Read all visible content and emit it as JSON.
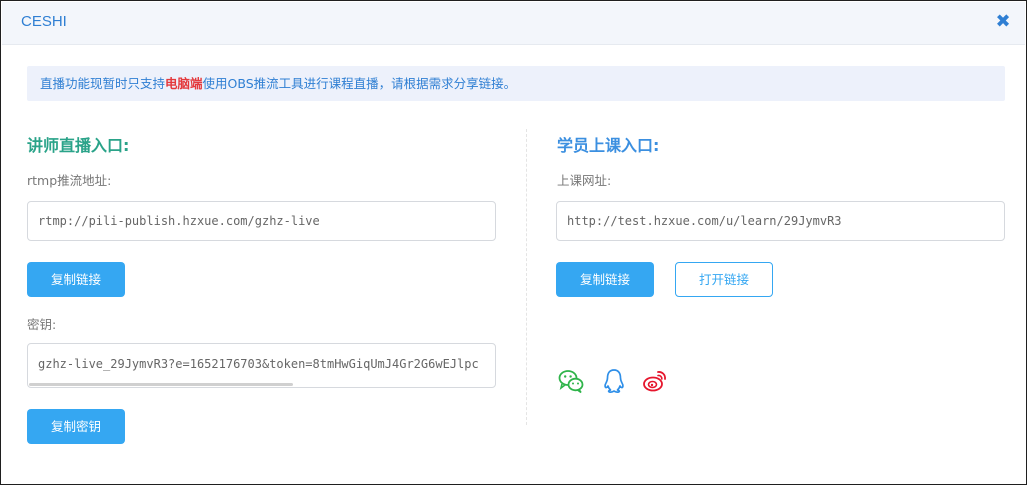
{
  "dialog": {
    "title": "CESHI",
    "close_glyph": "✖"
  },
  "notice": {
    "text_before": "直播功能现暂时只支持",
    "highlight": "电脑端",
    "text_after": "使用OBS推流工具进行课程直播，请根据需求分享链接。"
  },
  "teacher": {
    "title": "讲师直播入口:",
    "rtmp_label": "rtmp推流地址:",
    "rtmp_value": "rtmp://pili-publish.hzxue.com/gzhz-live",
    "copy_link_label": "复制链接",
    "key_label": "密钥:",
    "key_value": "gzhz-live_29JymvR3?e=1652176703&token=8tmHwGiqUmJ4Gr2G6wEJlpc",
    "copy_key_label": "复制密钥"
  },
  "student": {
    "title": "学员上课入口:",
    "url_label": "上课网址:",
    "url_value": "http://test.hzxue.com/u/learn/29JymvR3",
    "copy_link_label": "复制链接",
    "open_link_label": "打开链接"
  },
  "share": {
    "icons": [
      "wechat-icon",
      "qq-icon",
      "weibo-icon"
    ],
    "colors": {
      "wechat": "#2fb44a",
      "qq": "#2f8fe8",
      "weibo": "#e6162d"
    }
  },
  "colors": {
    "accent": "#2f7fd3",
    "button": "#35a7f2",
    "teacher_title": "#2aa389",
    "student_title": "#3b8fe0",
    "highlight": "#e4393c"
  }
}
